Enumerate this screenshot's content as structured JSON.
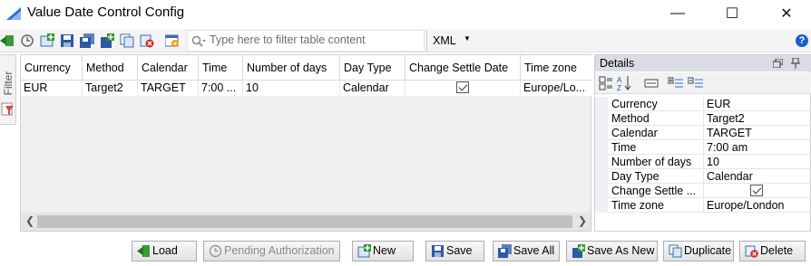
{
  "window": {
    "title": "Value Date Control Config",
    "minimize_label": "—",
    "maximize_label": "☐",
    "close_label": "✕"
  },
  "toolbar": {
    "filter_placeholder": "Type here to filter table content",
    "format_select": "XML",
    "help_label": "?"
  },
  "side_tab": {
    "filter_label": "Filter"
  },
  "grid": {
    "columns": [
      "Currency",
      "Method",
      "Calendar",
      "Time",
      "Number of days",
      "Day Type",
      "Change Settle Date",
      "Time zone"
    ],
    "rows": [
      {
        "currency": "EUR",
        "method": "Target2",
        "calendar": "TARGET",
        "time": "7:00 ...",
        "number_of_days": "10",
        "day_type": "Calendar",
        "change_settle_date": true,
        "time_zone": "Europe/Lo..."
      }
    ]
  },
  "details": {
    "title": "Details",
    "properties": [
      {
        "key": "Currency",
        "value": "EUR"
      },
      {
        "key": "Method",
        "value": "Target2"
      },
      {
        "key": "Calendar",
        "value": "TARGET"
      },
      {
        "key": "Time",
        "value": "7:00 am"
      },
      {
        "key": "Number of days",
        "value": "10"
      },
      {
        "key": "Day Type",
        "value": "Calendar"
      },
      {
        "key": "Change Settle ...",
        "value": ""
      },
      {
        "key": "Time zone",
        "value": "Europe/London"
      }
    ]
  },
  "buttons": {
    "load": "Load",
    "pending": "Pending Authorization",
    "new": "New",
    "save": "Save",
    "save_all": "Save All",
    "save_as_new": "Save As New",
    "duplicate": "Duplicate",
    "delete": "Delete"
  }
}
